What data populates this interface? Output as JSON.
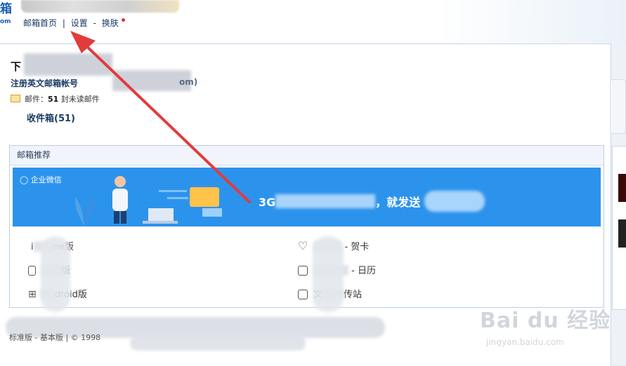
{
  "header": {
    "logo_text": "箱",
    "logo_sub": "om",
    "links": [
      "邮箱首页",
      "|",
      "设置",
      "-",
      "换肤"
    ]
  },
  "account": {
    "greeting_prefix": "下",
    "register_label": "注册英文邮箱帐号",
    "register_suffix": "om)",
    "mail_label": "邮件：",
    "unread_count": "51",
    "unread_text": "封未读邮件",
    "inbox_label": "收件箱(51)"
  },
  "recommend": {
    "title": "邮箱推荐",
    "banner_label": "企业微信",
    "banner_text_prefix": "3G",
    "banner_text_mid": "，就发送",
    "left_links": [
      "i",
      "ne版",
      "版",
      "droid版"
    ],
    "right_links": [
      "- 贺卡",
      "- 日历",
      "文",
      "传站"
    ]
  },
  "footer": {
    "text": "标准版 - 基本版 | © 1998"
  },
  "watermark": {
    "brand": "Bai du 经验",
    "url": "jingyan.baidu.com"
  },
  "colors": {
    "accent": "#2c93ec",
    "arrow": "#e23b3b",
    "link": "#1b3a63"
  }
}
